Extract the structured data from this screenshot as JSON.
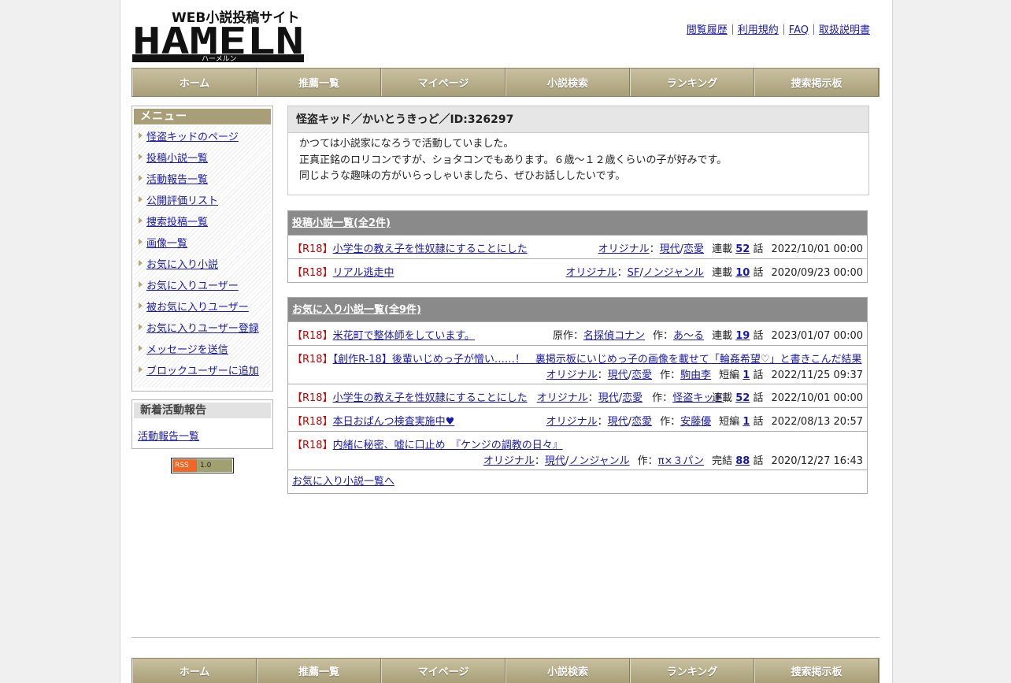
{
  "logo": {
    "main": "HAMELN",
    "tagline": "WEB小説投稿サイト",
    "sub": "ハーメルン"
  },
  "top_links": [
    "閲覧履歴",
    "利用規約",
    "FAQ",
    "取扱説明書"
  ],
  "nav": [
    "ホーム",
    "推薦一覧",
    "マイページ",
    "小説検索",
    "ランキング",
    "捜索掲示板"
  ],
  "sidebar": {
    "menu_title": "メニュー",
    "menu_items": [
      "怪盗キッドのページ",
      "投稿小説一覧",
      "活動報告一覧",
      "公開評価リスト",
      "捜索投稿一覧",
      "画像一覧",
      "お気に入り小説",
      "お気に入りユーザー",
      "被お気に入りユーザー",
      "お気に入りユーザー登録",
      "メッセージを送信",
      "ブロックユーザーに追加"
    ],
    "news_title": "新着活動報告",
    "news_link": "活動報告一覧",
    "rss_left": "RSS",
    "rss_right": "1.0"
  },
  "profile": {
    "title": "怪盗キッド／かいとうきっど／ID:326297",
    "lines": [
      "かつては小説家になろうで活動していました。",
      "正真正銘のロリコンですが、ショタコンでもあります。６歳～１２歳くらいの子が好みです。",
      "同じような趣味の方がいらっしゃいましたら、ぜひお話ししたいです。"
    ]
  },
  "posted": {
    "header": "投稿小説一覧(全2件)",
    "rows": [
      {
        "tag": "【R18】",
        "title": "小学生の教え子を性奴隷にすることにした",
        "origin": "オリジナル",
        "genre1": "現代",
        "genre2": "恋愛",
        "status": "連載",
        "count": "52",
        "unit": "話",
        "date": "2022/10/01 00:00"
      },
      {
        "tag": "【R18】",
        "title": "リアル逃走中",
        "origin": "オリジナル",
        "genre1": "SF",
        "genre2": "ノンジャンル",
        "status": "連載",
        "count": "10",
        "unit": "話",
        "date": "2020/09/23 00:00"
      }
    ]
  },
  "favorites": {
    "header": "お気に入り小説一覧(全9件)",
    "more_link": "お気に入り小説一覧へ",
    "rows": [
      {
        "tag": "【R18】",
        "title": "米花町で整体師をしています。",
        "origin_label": "原作：",
        "origin": "名探偵コナン",
        "author_label": "作：",
        "author": "あ～る",
        "status": "連載",
        "count": "19",
        "unit": "話",
        "date": "2023/01/07 00:00"
      },
      {
        "tag": "【R18】",
        "title": "【創作R-18】後輩いじめっ子が憎い……！　裏掲示板にいじめっ子の画像を載せて「輪姦希望♡」と書きこんだ結果",
        "origin": "オリジナル",
        "genre1": "現代",
        "genre2": "恋愛",
        "author_label": "作：",
        "author": "駒由李",
        "status": "短編",
        "count": "1",
        "unit": "話",
        "date": "2022/11/25 09:37"
      },
      {
        "tag": "【R18】",
        "title": "小学生の教え子を性奴隷にすることにした",
        "origin": "オリジナル",
        "genre1": "現代",
        "genre2": "恋愛",
        "author_label": "作：",
        "author": "怪盗キッド",
        "status": "連載",
        "count": "52",
        "unit": "話",
        "date": "2022/10/01 00:00"
      },
      {
        "tag": "【R18】",
        "title": "本日おぱんつ検査実施中♥",
        "origin": "オリジナル",
        "genre1": "現代",
        "genre2": "恋愛",
        "author_label": "作：",
        "author": "安藤優",
        "status": "短編",
        "count": "1",
        "unit": "話",
        "date": "2022/08/13 20:57"
      },
      {
        "tag": "【R18】",
        "title": "内緒に秘密、嘘に口止め　『ケンジの調教の日々』",
        "origin": "オリジナル",
        "genre1": "現代",
        "genre2": "ノンジャンル",
        "author_label": "作：",
        "author": "π×３パン",
        "status": "完結",
        "count": "88",
        "unit": "話",
        "date": "2020/12/27 16:43"
      }
    ]
  },
  "colors": {
    "nav_bg": "#a89e78",
    "table_header_bg": "#8a8a8a",
    "r18": "#cc0000",
    "link": "#1a1aa6"
  }
}
